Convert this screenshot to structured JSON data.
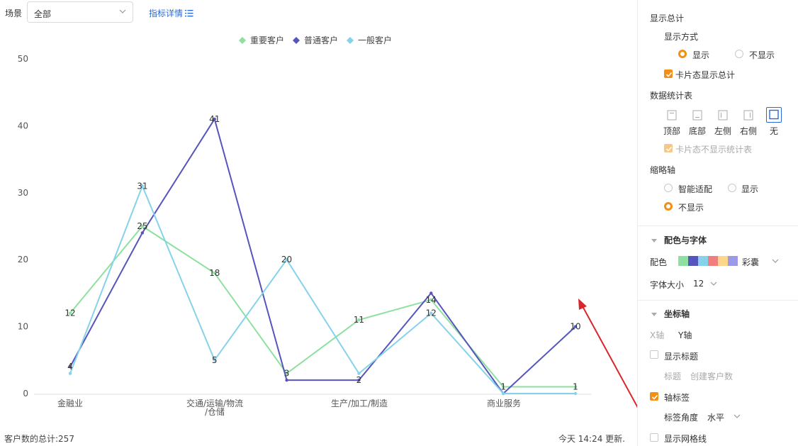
{
  "toolbar": {
    "scene_label": "场景",
    "scene_value": "全部",
    "metric_details": "指标详情"
  },
  "chart_data": {
    "type": "line",
    "categories": [
      "金融业",
      "",
      "交通/运输/物流/仓储",
      "",
      "生产/加工/制造",
      "",
      "商业服务",
      ""
    ],
    "x_tick_labels": [
      "金融业",
      "交通/运输/物流",
      "/仓储",
      "生产/加工/制造",
      "商业服务"
    ],
    "ylim": [
      0,
      50
    ],
    "yticks": [
      0,
      10,
      20,
      30,
      40,
      50
    ],
    "grid": false,
    "legend_position": "top-center",
    "series": [
      {
        "name": "重要客户",
        "color": "#8ee0a0",
        "values": [
          12,
          25,
          18,
          3,
          11,
          14,
          1,
          1
        ]
      },
      {
        "name": "普通客户",
        "color": "#5655bd",
        "values": [
          4,
          24,
          41,
          2,
          2,
          15,
          0,
          10
        ]
      },
      {
        "name": "一般客户",
        "color": "#86d2ea",
        "values": [
          3,
          31,
          5,
          20,
          3,
          12,
          0,
          0
        ]
      }
    ],
    "data_labels": [
      {
        "series": "重要客户",
        "index": 0,
        "text": "12"
      },
      {
        "series": "重要客户",
        "index": 1,
        "text": "25"
      },
      {
        "series": "重要客户",
        "index": 2,
        "text": "18"
      },
      {
        "series": "重要客户",
        "index": 3,
        "text": "3"
      },
      {
        "series": "重要客户",
        "index": 4,
        "text": "11"
      },
      {
        "series": "重要客户",
        "index": 5,
        "text": "14"
      },
      {
        "series": "重要客户",
        "index": 6,
        "text": "1"
      },
      {
        "series": "重要客户",
        "index": 7,
        "text": "1"
      },
      {
        "series": "普通客户",
        "index": 0,
        "text": "4"
      },
      {
        "series": "普通客户",
        "index": 2,
        "text": "41"
      },
      {
        "series": "普通客户",
        "index": 4,
        "text": "2"
      },
      {
        "series": "普通客户",
        "index": 7,
        "text": "10"
      },
      {
        "series": "一般客户",
        "index": 1,
        "text": "31"
      },
      {
        "series": "一般客户",
        "index": 2,
        "text": "5"
      },
      {
        "series": "一般客户",
        "index": 3,
        "text": "20"
      },
      {
        "series": "一般客户",
        "index": 5,
        "text": "12"
      }
    ]
  },
  "footer": {
    "total": "客户数的总计:257",
    "updated": "今天 14:24 更新."
  },
  "panel": {
    "show_total": "显示总计",
    "display_mode": "显示方式",
    "opt_show": "显示",
    "opt_hide": "不显示",
    "display_selected": "显示",
    "card_show_total": "卡片态显示总计",
    "card_show_total_checked": true,
    "stats_table": "数据统计表",
    "positions": [
      "顶部",
      "底部",
      "左侧",
      "右侧",
      "无"
    ],
    "position_selected": "无",
    "card_hide_stats": "卡片态不显示统计表",
    "card_hide_stats_checked": true,
    "thumb_axis": "缩略轴",
    "thumb_opts": [
      "智能适配",
      "显示",
      "不显示"
    ],
    "thumb_selected": "不显示",
    "color_font": "配色与字体",
    "color_label": "配色",
    "palette_name": "彩囊",
    "palette": [
      "#8ee0a0",
      "#5655bd",
      "#86d2ea",
      "#f07e7e",
      "#fcd68a",
      "#9b9ae8"
    ],
    "font_size_label": "字体大小",
    "font_size_value": "12",
    "axis": "坐标轴",
    "x_axis": "X轴",
    "y_axis": "Y轴",
    "show_title": "显示标题",
    "show_title_checked": false,
    "title_label": "标题",
    "title_value": "创建客户数",
    "axis_labels": "轴标签",
    "axis_labels_checked": true,
    "label_angle": "标签角度",
    "label_angle_value": "水平",
    "show_grid": "显示网格线",
    "show_grid_checked": false
  },
  "colors": {
    "accent": "#f29016",
    "link": "#2a6ad8",
    "annotation_arrow": "#d9262c"
  }
}
